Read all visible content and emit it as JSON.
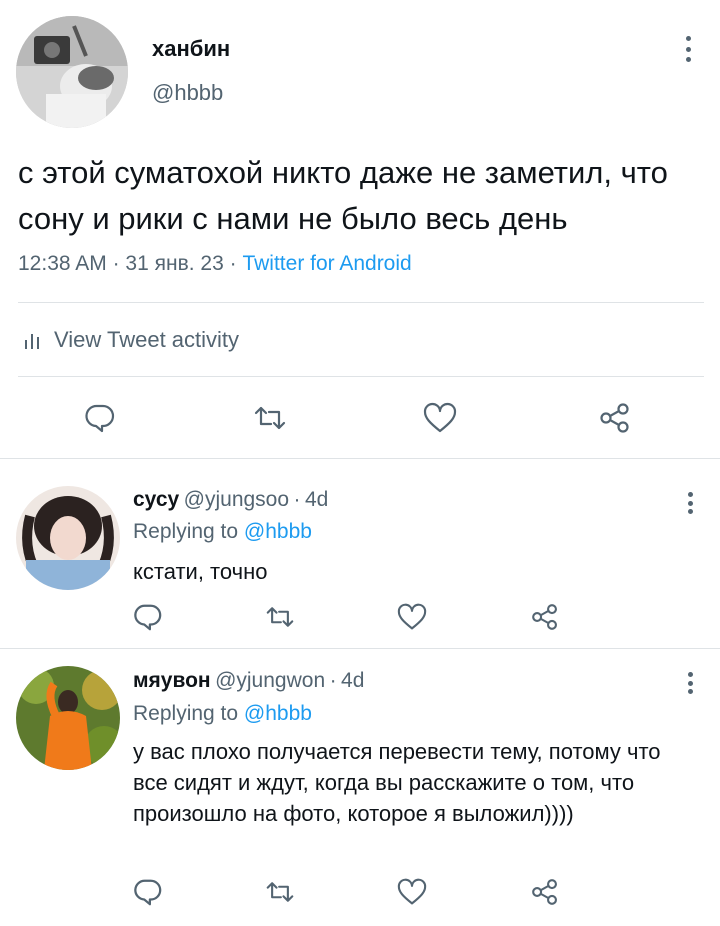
{
  "main_tweet": {
    "display_name": "ханбин",
    "handle": "@hbbb",
    "text": "с этой суматохой никто даже не заметил, что сону и рики с нами не было весь день",
    "time": "12:38 AM",
    "date": "31 янв. 23",
    "separator": "·",
    "source": "Twitter for Android",
    "activity_label": "View Tweet activity"
  },
  "replies": [
    {
      "display_name": "сусу",
      "handle": "@yjungsoo",
      "age": "4d",
      "replying_prefix": "Replying to",
      "replying_handle": "@hbbb",
      "text": "кстати, точно"
    },
    {
      "display_name": "мяувон",
      "handle": "@yjungwon",
      "age": "4d",
      "replying_prefix": "Replying to",
      "replying_handle": "@hbbb",
      "text": "у вас плохо получается перевести тему, потому что все сидят и ждут, когда вы расскажите о том, что произошло на фото, которое я выложил))))"
    }
  ],
  "colors": {
    "text": "#0f1419",
    "secondary": "#536471",
    "link": "#1d9bf0",
    "divider": "#dfe3e6"
  },
  "icons": [
    "more-icon",
    "reply-icon",
    "retweet-icon",
    "like-icon",
    "share-icon",
    "bar-chart-icon"
  ]
}
